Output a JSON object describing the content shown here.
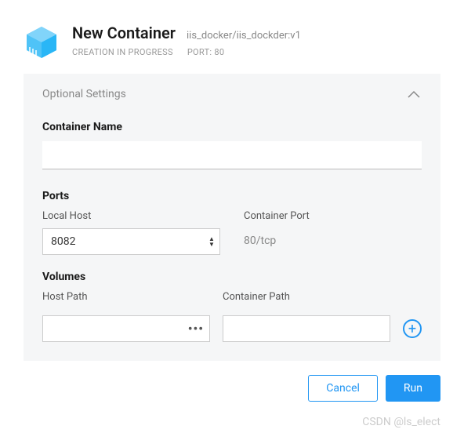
{
  "header": {
    "title": "New Container",
    "image": "iis_docker/iis_dockder:v1",
    "status": "CREATION IN PROGRESS",
    "port_meta": "PORT: 80"
  },
  "panel": {
    "title": "Optional Settings",
    "container_name": {
      "label": "Container Name",
      "value": ""
    },
    "ports": {
      "label": "Ports",
      "local_host_label": "Local Host",
      "container_port_label": "Container Port",
      "local_host_value": "8082",
      "container_port_value": "80/tcp"
    },
    "volumes": {
      "label": "Volumes",
      "host_path_label": "Host Path",
      "container_path_label": "Container Path",
      "host_path_value": "",
      "container_path_value": ""
    }
  },
  "footer": {
    "cancel": "Cancel",
    "run": "Run"
  },
  "watermark": "CSDN @ls_elect"
}
